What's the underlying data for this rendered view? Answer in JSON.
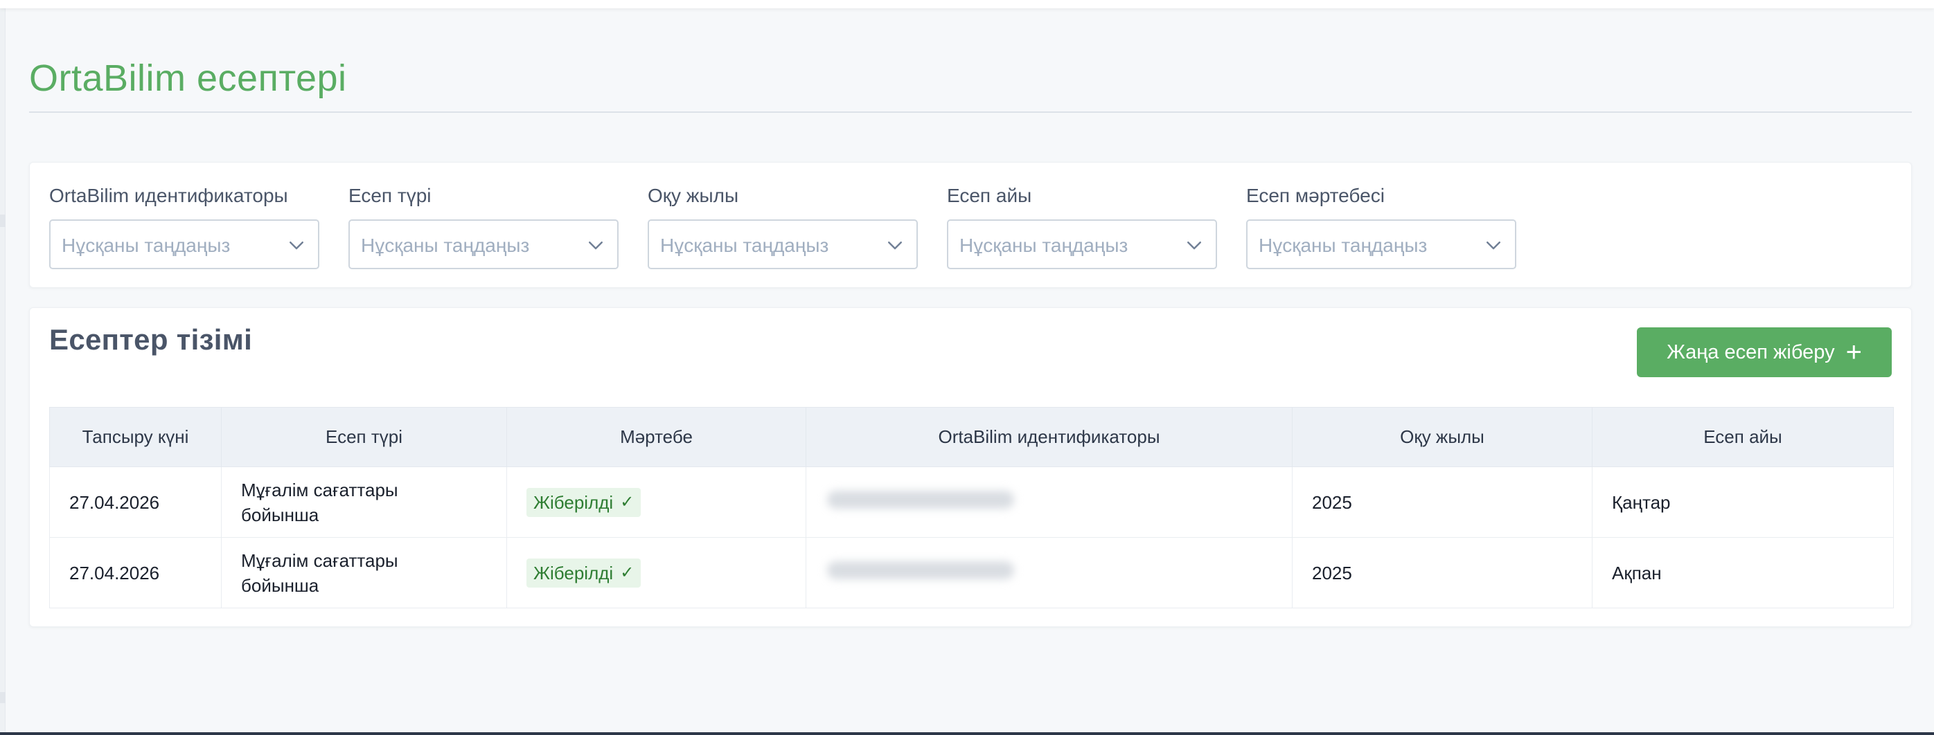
{
  "page": {
    "title": "OrtaBilim есептері"
  },
  "filters": [
    {
      "label": "OrtaBilim идентификаторы",
      "placeholder": "Нұсқаны таңдаңыз"
    },
    {
      "label": "Есеп түрі",
      "placeholder": "Нұсқаны таңдаңыз"
    },
    {
      "label": "Оқу жылы",
      "placeholder": "Нұсқаны таңдаңыз"
    },
    {
      "label": "Есеп айы",
      "placeholder": "Нұсқаны таңдаңыз"
    },
    {
      "label": "Есеп мәртебесі",
      "placeholder": "Нұсқаны таңдаңыз"
    }
  ],
  "reports": {
    "title": "Есептер тізімі",
    "new_button_label": "Жаңа есеп жіберу",
    "new_button_icon": "plus-icon",
    "columns": [
      "Тапсыру күні",
      "Есеп түрі",
      "Мәртебе",
      "OrtaBilim идентификаторы",
      "Оқу жылы",
      "Есеп айы"
    ],
    "rows": [
      {
        "date": "27.04.2026",
        "type": "Мұғалім сағаттары бойынша",
        "status": "Жіберілді",
        "year": "2025",
        "month": "Қаңтар"
      },
      {
        "date": "27.04.2026",
        "type": "Мұғалім сағаттары бойынша",
        "status": "Жіберілді",
        "year": "2025",
        "month": "Ақпан"
      }
    ]
  },
  "colors": {
    "accent": "#5aad63",
    "badge_bg": "#e8f5e9",
    "badge_text": "#2e7d32",
    "header_bg": "#edf1f6"
  }
}
